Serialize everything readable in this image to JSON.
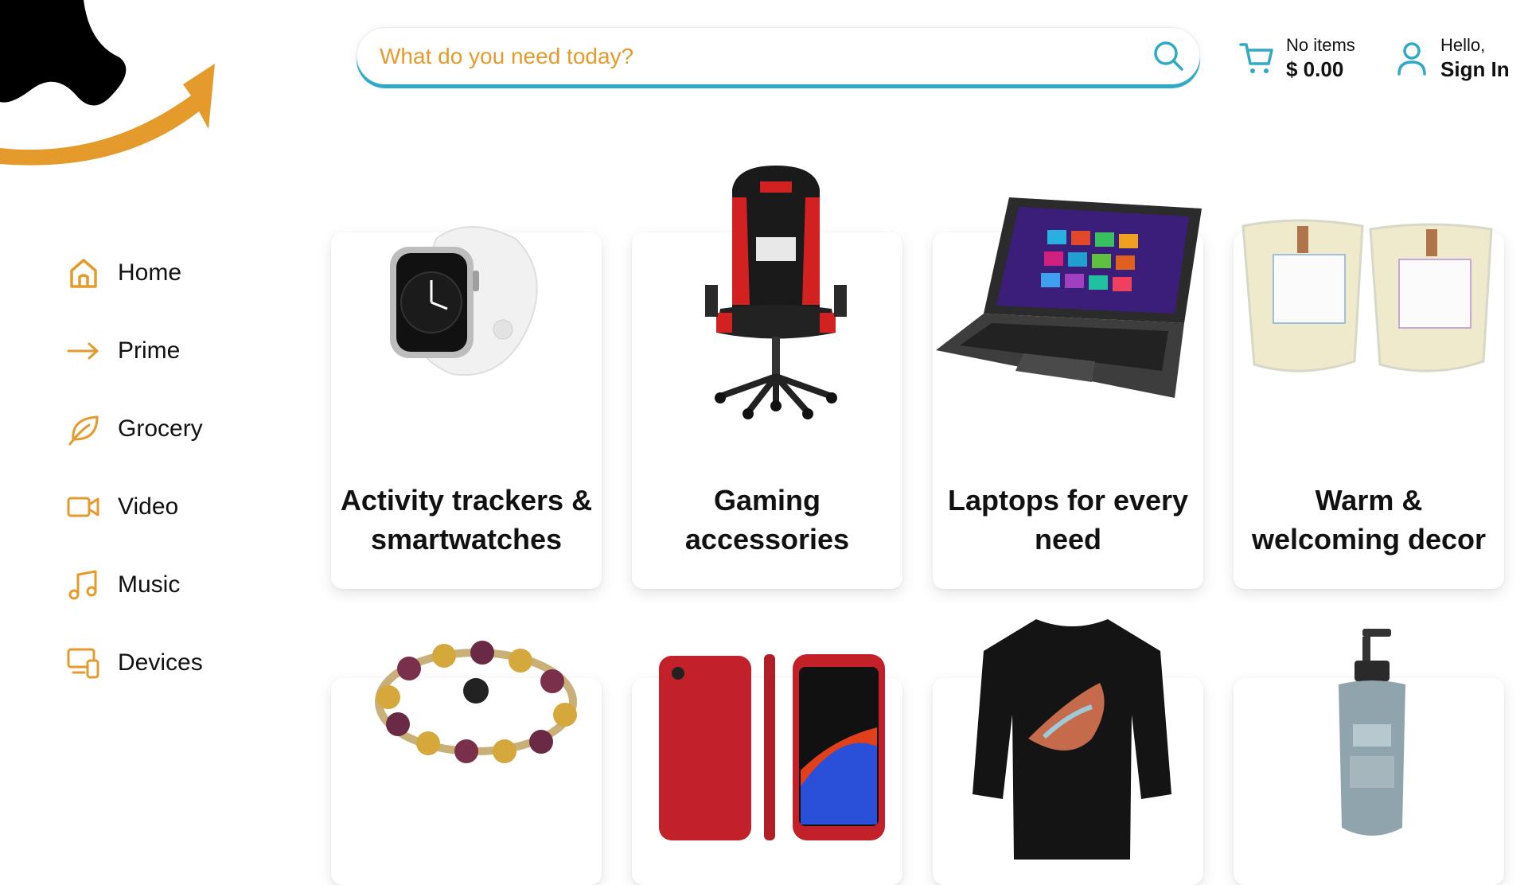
{
  "header": {
    "search": {
      "placeholder": "What do you need today?"
    },
    "cart": {
      "items_text": "No items",
      "total": "$ 0.00"
    },
    "account": {
      "greeting": "Hello,",
      "action": "Sign In"
    }
  },
  "sidebar": {
    "items": [
      {
        "label": "Home",
        "icon": "home-icon"
      },
      {
        "label": "Prime",
        "icon": "arrow-right-icon"
      },
      {
        "label": "Grocery",
        "icon": "leaf-icon"
      },
      {
        "label": "Video",
        "icon": "video-camera-icon"
      },
      {
        "label": "Music",
        "icon": "music-note-icon"
      },
      {
        "label": "Devices",
        "icon": "devices-icon"
      }
    ]
  },
  "categories": [
    {
      "title": "Activity trackers & smartwatches",
      "image": "smartwatch-image"
    },
    {
      "title": "Gaming accessories",
      "image": "gaming-chair-image"
    },
    {
      "title": "Laptops for every need",
      "image": "laptop-image"
    },
    {
      "title": "Warm & welcoming decor",
      "image": "candles-image"
    },
    {
      "title": "",
      "image": "charm-bracelet-image"
    },
    {
      "title": "",
      "image": "red-iphone-image"
    },
    {
      "title": "",
      "image": "black-tshirt-image"
    },
    {
      "title": "",
      "image": "shampoo-bottle-image"
    }
  ],
  "colors": {
    "accent": "#e59a2c",
    "search_underline": "#2fa9c5",
    "text": "#111111"
  }
}
